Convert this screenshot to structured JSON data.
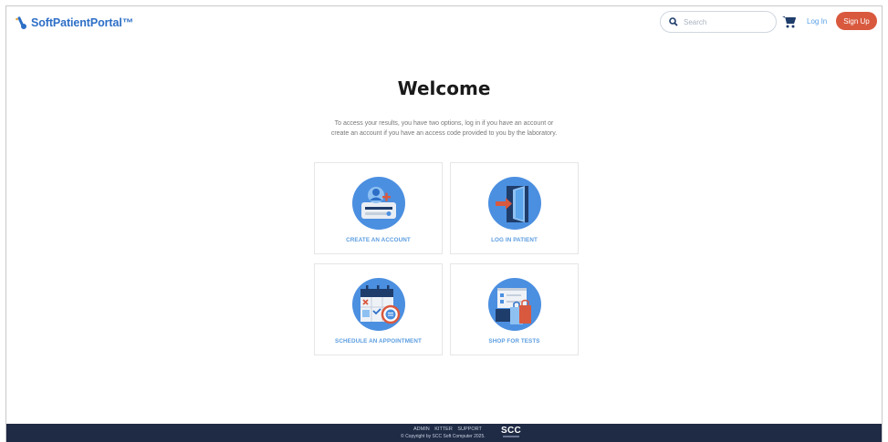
{
  "header": {
    "brand": "SoftPatientPortal™",
    "search_placeholder": "Search",
    "login_label": "Log In",
    "signup_label": "Sign Up"
  },
  "main": {
    "title": "Welcome",
    "intro_line1": "To access your results, you have two options, log in if you have an account or",
    "intro_line2": "create an account if you have an access code provided to you by the laboratory.",
    "cards": [
      {
        "label": "CREATE AN ACCOUNT",
        "icon": "create-account-icon"
      },
      {
        "label": "LOG IN PATIENT",
        "icon": "login-door-icon"
      },
      {
        "label": "SCHEDULE AN APPOINTMENT",
        "icon": "calendar-icon"
      },
      {
        "label": "SHOP FOR TESTS",
        "icon": "shopping-bag-icon"
      }
    ]
  },
  "footer": {
    "links": [
      "ADMIN",
      "KITTER",
      "SUPPORT"
    ],
    "copyright": "© Copyright by SCC Soft Computer 2025.",
    "logo_text": "SCC"
  },
  "colors": {
    "brand_blue": "#2d6fc7",
    "accent_orange": "#d9593e",
    "card_label_blue": "#5b9de0",
    "footer_bg": "#1f2a44"
  }
}
